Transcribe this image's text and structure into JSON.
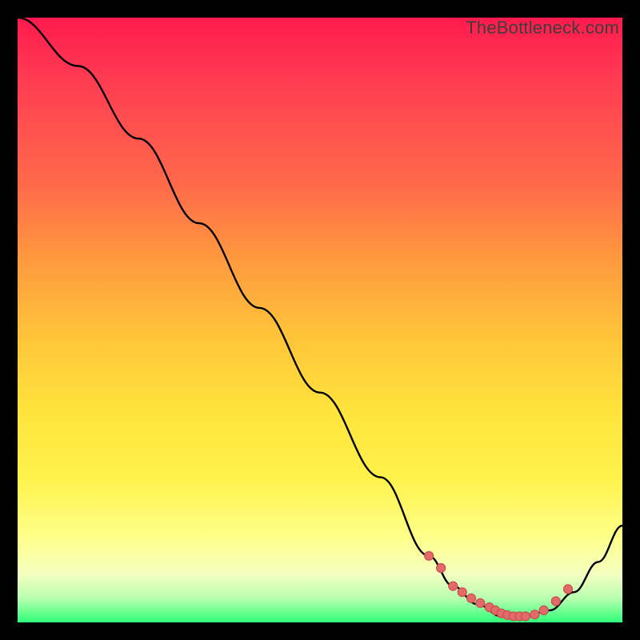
{
  "watermark": "TheBottleneck.com",
  "colors": {
    "gradient_top": "#ff1a4d",
    "gradient_mid": "#ffe13c",
    "gradient_bottom": "#2fff78",
    "line": "#000000",
    "dot_fill": "#e46a6a",
    "dot_stroke": "#c74f4f",
    "frame": "#000000"
  },
  "chart_data": {
    "type": "line",
    "title": "",
    "xlabel": "",
    "ylabel": "",
    "xlim": [
      0,
      100
    ],
    "ylim": [
      0,
      100
    ],
    "series": [
      {
        "name": "curve",
        "x": [
          0,
          10,
          20,
          30,
          40,
          50,
          60,
          68,
          72,
          76,
          80,
          84,
          88,
          92,
          96,
          100
        ],
        "y": [
          100,
          92,
          80,
          66,
          52,
          38,
          24,
          11,
          6,
          3,
          1,
          1,
          2,
          5,
          10,
          16
        ]
      }
    ],
    "highlight_points": {
      "name": "dots",
      "x": [
        68,
        70,
        72,
        73.5,
        75,
        76.5,
        78,
        79,
        80,
        81,
        82,
        83,
        84,
        85.5,
        87,
        89,
        91
      ],
      "y": [
        11,
        9,
        6,
        5,
        4,
        3.2,
        2.5,
        2,
        1.5,
        1.2,
        1,
        1,
        1,
        1.3,
        2,
        3.5,
        5.5
      ]
    }
  }
}
